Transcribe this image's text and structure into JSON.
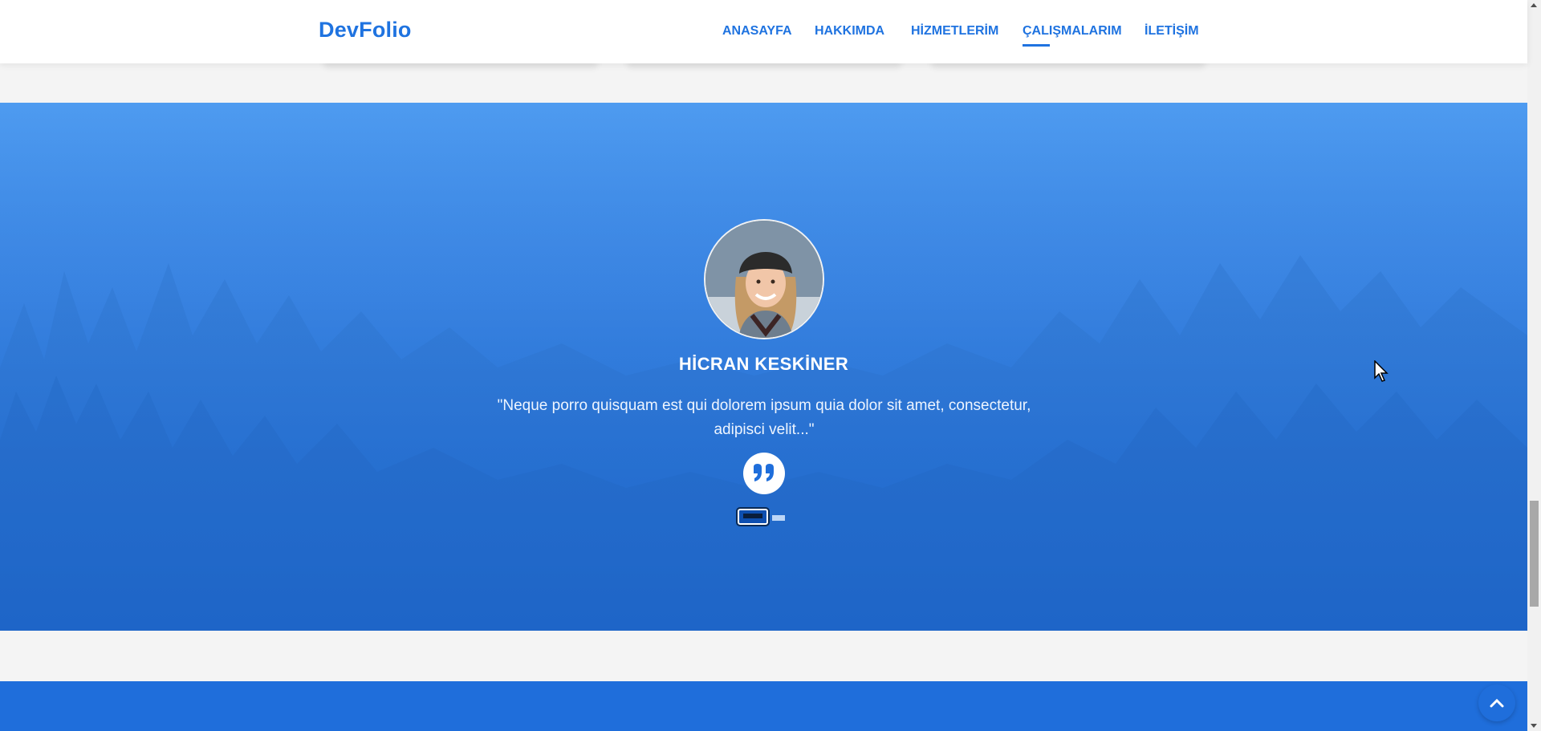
{
  "brand": "DevFolio",
  "nav": {
    "items": [
      {
        "label": "ANASAYFA"
      },
      {
        "label": "HAKKIMDA"
      },
      {
        "label": "HİZMETLERİM"
      },
      {
        "label": "ÇALIŞMALARIM"
      },
      {
        "label": "İLETİŞİM"
      }
    ],
    "active_index": 3
  },
  "testimonial": {
    "author": "HİCRAN KESKİNER",
    "quote": "\"Neque porro quisquam est qui dolorem ipsum quia dolor sit amet, consectetur, adipisci velit...\"",
    "slide_count": 2,
    "active_slide": 0
  },
  "icons": {
    "quote": "quote-icon",
    "back_to_top": "chevron-up-icon",
    "avatar": "avatar"
  },
  "colors": {
    "accent": "#1f73e0",
    "section_top": "#4e9bf0",
    "section_bottom": "#1d6dd9"
  }
}
